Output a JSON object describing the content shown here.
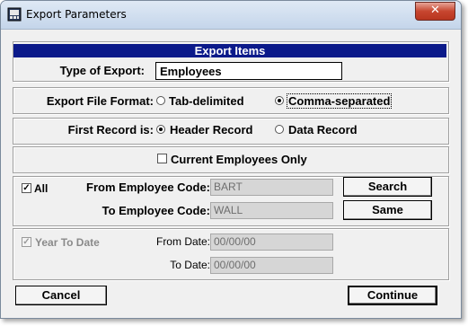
{
  "window": {
    "title": "Export Parameters",
    "close_label": "✕"
  },
  "export_items": {
    "header": "Export Items",
    "type_label": "Type of Export:",
    "type_value": "Employees"
  },
  "file_format": {
    "label": "Export File Format:",
    "options": [
      "Tab-delimited",
      "Comma-separated"
    ],
    "selected": "Comma-separated"
  },
  "first_record": {
    "label": "First Record is:",
    "options": [
      "Header Record",
      "Data Record"
    ],
    "selected": "Header Record"
  },
  "current_only": {
    "label": "Current Employees Only",
    "checked": false
  },
  "employee_range": {
    "all_label": "All",
    "all_checked": true,
    "from_label": "From Employee Code:",
    "from_value": "BART",
    "to_label": "To Employee Code:",
    "to_value": "WALL",
    "search_label": "Search",
    "same_label": "Same"
  },
  "date_range": {
    "ytd_label": "Year To Date",
    "ytd_checked": true,
    "from_label": "From Date:",
    "from_value": "00/00/00",
    "to_label": "To Date:",
    "to_value": "00/00/00"
  },
  "footer": {
    "cancel_label": "Cancel",
    "continue_label": "Continue"
  }
}
